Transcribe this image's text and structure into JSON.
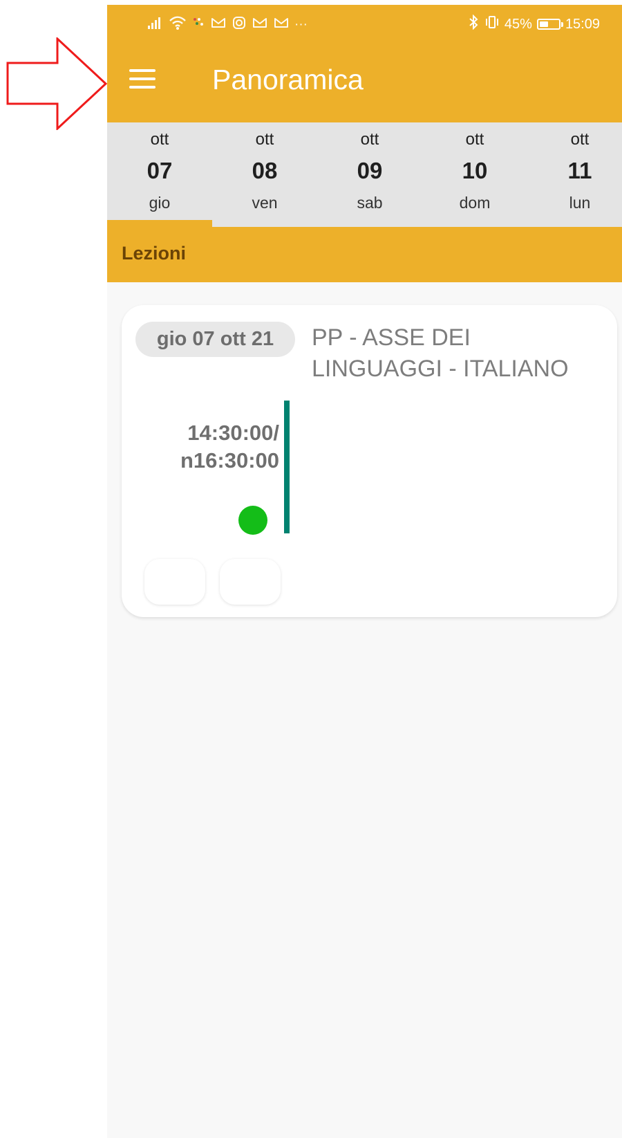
{
  "status_bar": {
    "left_icons": [
      "signal-icon",
      "wifi-icon",
      "notification-icon",
      "mail-icon",
      "instagram-icon",
      "mail-icon",
      "mail-icon",
      "more-icon"
    ],
    "right_icons": [
      "bluetooth-icon",
      "vibrate-icon"
    ],
    "battery_label": "45%",
    "battery_level": 0.45,
    "time": "15:09"
  },
  "app_bar": {
    "title": "Panoramica",
    "menu_icon": "hamburger-menu-icon"
  },
  "date_strip": {
    "dates": [
      {
        "month": "ott",
        "day": "07",
        "weekday": "gio",
        "selected": true
      },
      {
        "month": "ott",
        "day": "08",
        "weekday": "ven",
        "selected": false
      },
      {
        "month": "ott",
        "day": "09",
        "weekday": "sab",
        "selected": false
      },
      {
        "month": "ott",
        "day": "10",
        "weekday": "dom",
        "selected": false
      },
      {
        "month": "ott",
        "day": "11",
        "weekday": "lun",
        "selected": false
      }
    ]
  },
  "section": {
    "title": "Lezioni"
  },
  "lesson": {
    "date_label": "gio 07 ott 21",
    "title": "PP - ASSE DEI LINGUAGGI - ITALIANO",
    "time_range_line1": "14:30:00/",
    "time_range_line2": "n16:30:00",
    "status_color": "#14bd18",
    "bar_color": "#008270"
  },
  "annotation": {
    "shape": "right-arrow-icon",
    "color": "#ef1b1b"
  },
  "theme": {
    "primary": "#edb02a",
    "background": "#f8f8f8"
  }
}
